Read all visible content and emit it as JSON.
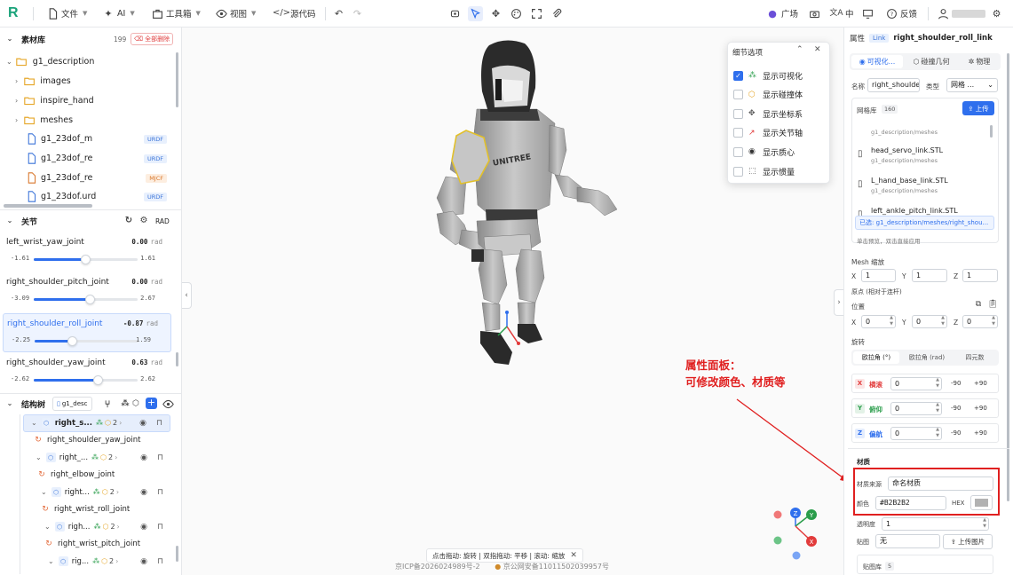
{
  "toolbar": {
    "logo": "R",
    "menus": [
      {
        "label": "文件",
        "icon": "file-icon"
      },
      {
        "label": "AI",
        "icon": "sparkle-icon"
      },
      {
        "label": "工具箱",
        "icon": "toolbox-icon"
      },
      {
        "label": "视图",
        "icon": "eye-icon"
      },
      {
        "label": "源代码",
        "icon": "code-icon"
      }
    ],
    "plaza": "广场",
    "lang": "中",
    "feedback": "反馈"
  },
  "assets": {
    "title": "素材库",
    "count": "199",
    "delete_all": "全部删除",
    "items": [
      {
        "label": "g1_description",
        "type": "folder-open"
      },
      {
        "label": "images",
        "type": "folder"
      },
      {
        "label": "inspire_hand",
        "type": "folder"
      },
      {
        "label": "meshes",
        "type": "folder"
      },
      {
        "label": "g1_23dof_m",
        "type": "file",
        "badge": "URDF"
      },
      {
        "label": "g1_23dof_re",
        "type": "file",
        "badge": "URDF"
      },
      {
        "label": "g1_23dof_re",
        "type": "file-mjcf",
        "badge": "MJCF"
      },
      {
        "label": "g1_23dof.urd",
        "type": "file",
        "badge": "URDF"
      }
    ]
  },
  "joints": {
    "title": "关节",
    "unit_toggle": "RAD",
    "unit": "rad",
    "items": [
      {
        "name": "left_wrist_yaw_joint",
        "value": "0.00",
        "min": "-1.61",
        "max": "1.61",
        "fraction": 0.5
      },
      {
        "name": "right_shoulder_pitch_joint",
        "value": "0.00",
        "min": "-3.09",
        "max": "2.67",
        "fraction": 0.54
      },
      {
        "name": "right_shoulder_roll_joint",
        "value": "-0.87",
        "min": "-2.25",
        "max": "1.59",
        "fraction": 0.36
      },
      {
        "name": "right_shoulder_yaw_joint",
        "value": "0.63",
        "min": "-2.62",
        "max": "2.62",
        "fraction": 0.62
      }
    ]
  },
  "structure": {
    "title": "结构树",
    "root_label": "g1_desc",
    "rows": [
      {
        "kind": "link",
        "label": "right_s...",
        "count": "2",
        "selected": true
      },
      {
        "kind": "joint",
        "label": "right_shoulder_yaw_joint"
      },
      {
        "kind": "link",
        "label": "right_...",
        "count": "2"
      },
      {
        "kind": "joint",
        "label": "right_elbow_joint"
      },
      {
        "kind": "link",
        "label": "right...",
        "count": "2"
      },
      {
        "kind": "joint",
        "label": "right_wrist_roll_joint"
      },
      {
        "kind": "link",
        "label": "righ...",
        "count": "2"
      },
      {
        "kind": "joint",
        "label": "right_wrist_pitch_joint"
      },
      {
        "kind": "link",
        "label": "rig...",
        "count": "2"
      }
    ]
  },
  "detail_options": {
    "title": "细节选项",
    "items": [
      {
        "label": "显示可视化",
        "checked": true
      },
      {
        "label": "显示碰撞体",
        "checked": false
      },
      {
        "label": "显示坐标系",
        "checked": false
      },
      {
        "label": "显示关节轴",
        "checked": false
      },
      {
        "label": "显示质心",
        "checked": false
      },
      {
        "label": "显示惯量",
        "checked": false
      }
    ]
  },
  "viewport": {
    "annotation_line1": "属性面板：",
    "annotation_line2": "可修改颜色、材质等",
    "hint": "点击拖动: 旋转 | 双指拖动: 平移 | 滚动: 缩放",
    "icp": "京ICP备2026024989号-2",
    "police": "京公网安备11011502039957号",
    "axes": [
      "Z",
      "Y",
      "X"
    ],
    "robot_logo": "UNITREE"
  },
  "properties": {
    "title": "属性",
    "tag": "Link",
    "link_name": "right_shoulder_roll_link",
    "tabs": [
      "可视化...",
      "碰撞几何",
      "物理"
    ],
    "name_label": "名称",
    "name_value": "right_shoulde",
    "type_label": "类型",
    "type_value": "网格 ...",
    "mesh_lib_label": "网格库",
    "mesh_lib_count": "160",
    "upload": "上传",
    "mesh_items": [
      {
        "name": "",
        "path": "g1_description/meshes"
      },
      {
        "name": "head_servo_link.STL",
        "path": "g1_description/meshes"
      },
      {
        "name": "L_hand_base_link.STL",
        "path": "g1_description/meshes"
      },
      {
        "name": "left_ankle_pitch_link.STL",
        "path": ""
      }
    ],
    "selected_path": "已选: g1_description/meshes/right_shou...",
    "mesh_hint": "单击预览，双击直接应用",
    "scale_label": "Mesh 缩放",
    "scale": {
      "x": "1",
      "y": "1",
      "z": "1"
    },
    "origin_label": "原点 (相对于连杆)",
    "position_label": "位置",
    "position": {
      "x": "0",
      "y": "0",
      "z": "0"
    },
    "rotation_label": "旋转",
    "rotation_tabs": [
      "欧拉角 (°)",
      "欧拉角 (rad)",
      "四元数"
    ],
    "rotation_rows": [
      {
        "axis": "X",
        "name": "横滚",
        "value": "0",
        "min": "-90",
        "max": "+90",
        "color": "#e23b3b"
      },
      {
        "axis": "Y",
        "name": "俯仰",
        "value": "0",
        "min": "-90",
        "max": "+90",
        "color": "#2a9d4b"
      },
      {
        "axis": "Z",
        "name": "偏航",
        "value": "0",
        "min": "-90",
        "max": "+90",
        "color": "#2f6fed"
      }
    ],
    "material_label": "材质",
    "material_source_label": "材质来源",
    "material_source_value": "命名材质",
    "color_label": "颜色",
    "color_value": "#B2B2B2",
    "hex_label": "HEX",
    "swatch_color": "#B2B2B2",
    "opacity_label": "透明度",
    "opacity_value": "1",
    "texture_label": "贴图",
    "texture_value": "无",
    "upload_image": "上传图片",
    "texture_lib_label": "贴图库",
    "texture_lib_count": "5"
  }
}
